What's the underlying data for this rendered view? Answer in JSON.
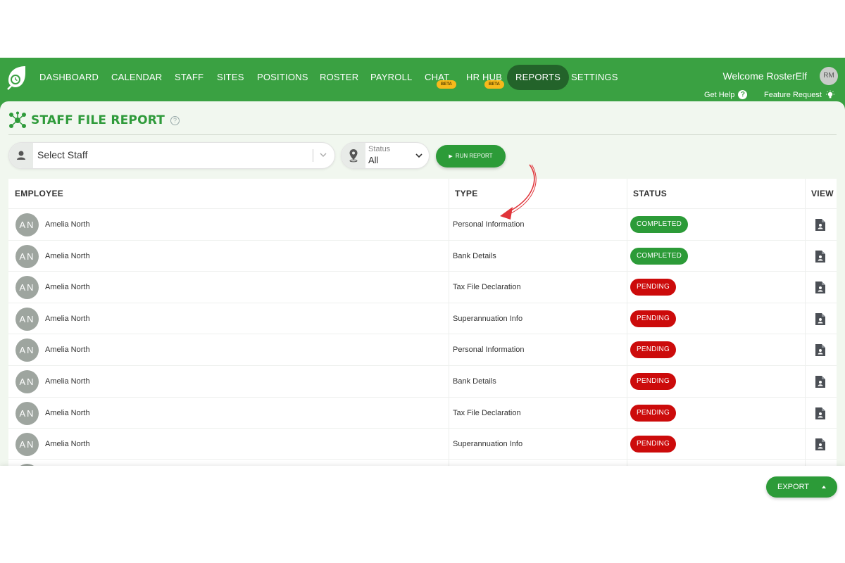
{
  "nav": {
    "items": [
      {
        "label": "DASHBOARD",
        "beta": ""
      },
      {
        "label": "CALENDAR",
        "beta": ""
      },
      {
        "label": "STAFF",
        "beta": ""
      },
      {
        "label": "SITES",
        "beta": ""
      },
      {
        "label": "POSITIONS",
        "beta": ""
      },
      {
        "label": "ROSTER",
        "beta": ""
      },
      {
        "label": "PAYROLL",
        "beta": ""
      },
      {
        "label": "CHAT",
        "beta": "BETA"
      },
      {
        "label": "HR HUB",
        "beta": "BETA"
      },
      {
        "label": "REPORTS",
        "beta": ""
      },
      {
        "label": "SETTINGS",
        "beta": ""
      }
    ],
    "active": "REPORTS",
    "welcome": "Welcome RosterElf",
    "avatar": "RM",
    "get_help": "Get Help",
    "feature_request": "Feature Request"
  },
  "page": {
    "title": "STAFF FILE REPORT"
  },
  "filters": {
    "staff_placeholder": "Select Staff",
    "status_label": "Status",
    "status_value": "All",
    "run_button": "RUN REPORT"
  },
  "table": {
    "headers": [
      "EMPLOYEE",
      "TYPE",
      "STATUS",
      "VIEW"
    ],
    "rows": [
      {
        "initials": "AN",
        "name": "Amelia North",
        "type": "Personal Information",
        "status": "COMPLETED"
      },
      {
        "initials": "AN",
        "name": "Amelia North",
        "type": "Bank Details",
        "status": "COMPLETED"
      },
      {
        "initials": "AN",
        "name": "Amelia North",
        "type": "Tax File Declaration",
        "status": "PENDING"
      },
      {
        "initials": "AN",
        "name": "Amelia North",
        "type": "Superannuation Info",
        "status": "PENDING"
      },
      {
        "initials": "AN",
        "name": "Amelia North",
        "type": "Personal Information",
        "status": "PENDING"
      },
      {
        "initials": "AN",
        "name": "Amelia North",
        "type": "Bank Details",
        "status": "PENDING"
      },
      {
        "initials": "AN",
        "name": "Amelia North",
        "type": "Tax File Declaration",
        "status": "PENDING"
      },
      {
        "initials": "AN",
        "name": "Amelia North",
        "type": "Superannuation Info",
        "status": "PENDING"
      }
    ]
  },
  "footer": {
    "export_button": "EXPORT"
  },
  "colors": {
    "brand_green": "#3aa142",
    "active_nav": "#23632a",
    "completed": "#2c9b38",
    "pending": "#cc0b0b",
    "beta": "#f7b91b"
  }
}
